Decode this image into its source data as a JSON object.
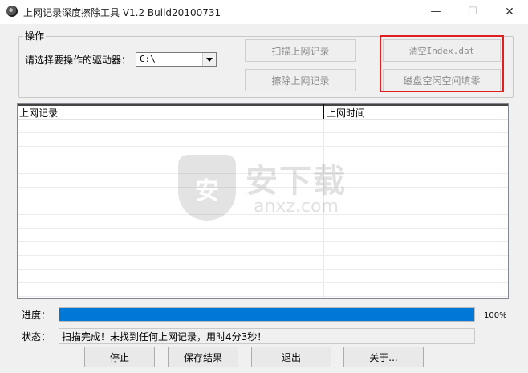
{
  "window": {
    "title": "上网记录深度擦除工具 V1.2   Build20100731",
    "minimize": "—",
    "maximize": "☐",
    "close": "✕"
  },
  "operations": {
    "group_label": "操作",
    "drive_label": "请选择要操作的驱动器：",
    "drive_value": "C:\\",
    "scan_button": "扫描上网记录",
    "erase_button": "擦除上网记录",
    "clear_index_button": "清空Index.dat",
    "wipe_free_space_button": "磁盘空闲空间填零"
  },
  "list": {
    "columns": [
      "上网记录",
      "上网时间"
    ],
    "rows": []
  },
  "watermark": {
    "badge": "安",
    "title": "安下载",
    "subtitle": "anxz.com"
  },
  "progress": {
    "label": "进度：",
    "value": 1.0,
    "percent_text": "100%"
  },
  "status": {
    "label": "状态：",
    "text": "扫描完成！未找到任何上网记录，用时4分3秒！"
  },
  "bottom_buttons": {
    "stop": "停止",
    "save": "保存结果",
    "exit": "退出",
    "about": "关于..."
  },
  "colors": {
    "progress_fill": "#0078d7",
    "highlight_box": "#e02020"
  }
}
